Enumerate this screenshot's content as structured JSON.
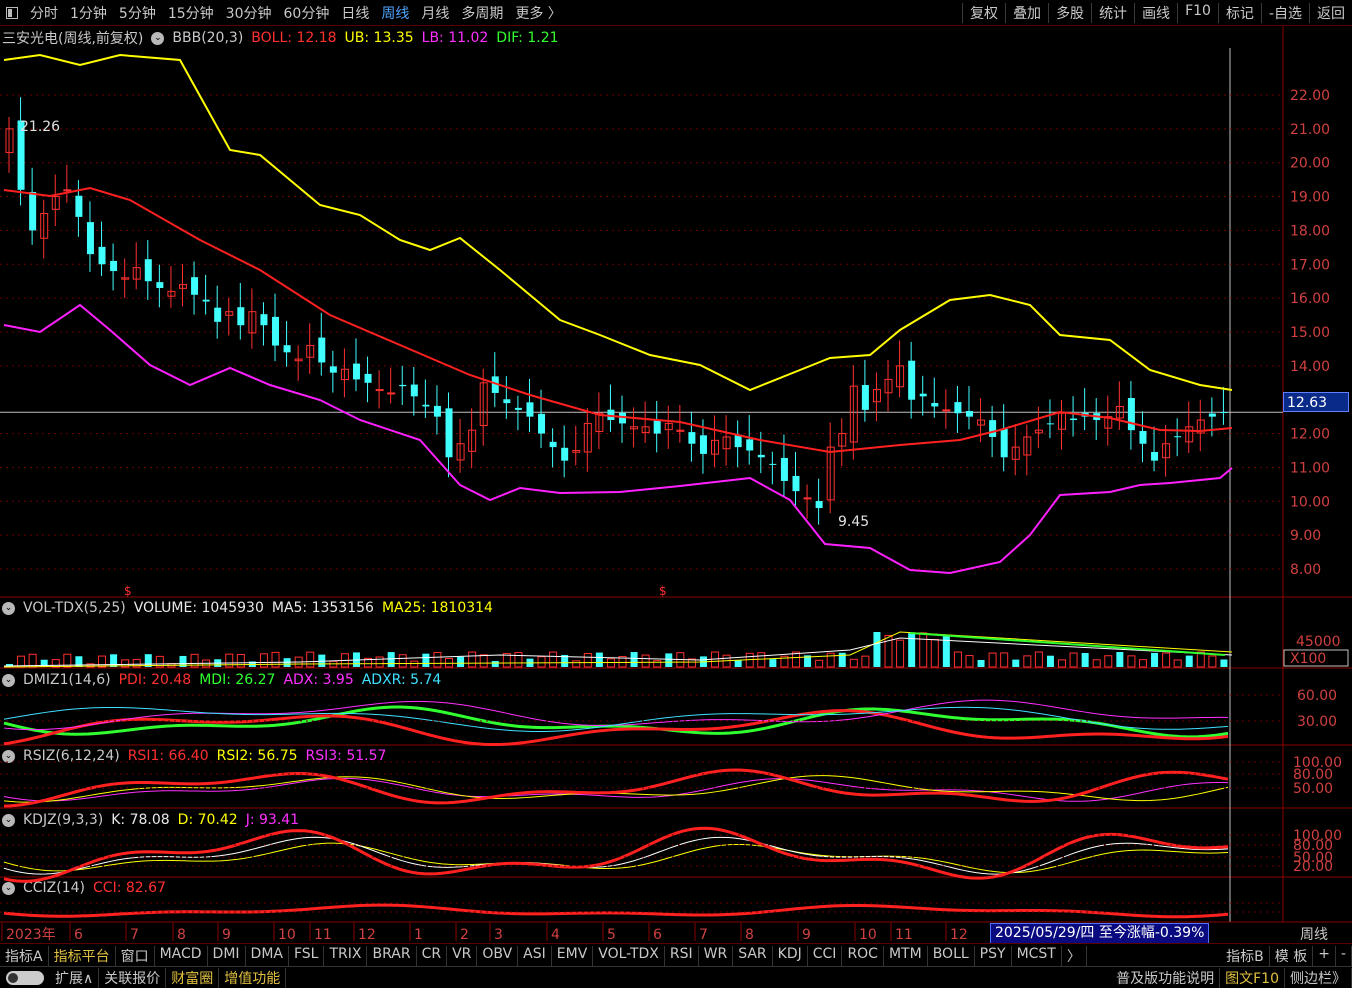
{
  "topbar": {
    "periods": [
      "分时",
      "1分钟",
      "5分钟",
      "15分钟",
      "30分钟",
      "60分钟",
      "日线",
      "周线",
      "月线",
      "多周期",
      "更多 〉"
    ],
    "active_period": "周线",
    "right_buttons": [
      "复权",
      "叠加",
      "多股",
      "统计",
      "画线",
      "F10",
      "标记",
      "-自选",
      "返回"
    ]
  },
  "main": {
    "title": "三安光电(周线,前复权)",
    "indicator": "BBB(20,3)",
    "boll": "BOLL: 12.18",
    "ub": "UB: 13.35",
    "lb": "LB: 11.02",
    "dif": "DIF: 1.21",
    "high_label": "21.26",
    "low_label": "9.45",
    "current_price": "12.63",
    "price_ticks": [
      "22.00",
      "21.00",
      "20.00",
      "19.00",
      "18.00",
      "17.00",
      "16.00",
      "15.00",
      "14.00",
      "12.00",
      "11.00",
      "10.00",
      "9.00",
      "8.00"
    ],
    "dividend_mark": "$",
    "colors": {
      "boll": "#ff2020",
      "ub": "#ffff00",
      "lb": "#ff20ff",
      "up": "#ff3030",
      "down": "#40ffff"
    }
  },
  "vol": {
    "name": "VOL-TDX(5,25)",
    "volume": "VOLUME: 1045930",
    "ma5": "MA5: 1353156",
    "ma25": "MA25: 1810314",
    "tick": "45000",
    "unit": "X100"
  },
  "dmi": {
    "name": "DMIZ1(14,6)",
    "pdi": "PDI: 20.48",
    "mdi": "MDI: 26.27",
    "adx": "ADX: 3.95",
    "adxr": "ADXR: 5.74",
    "ticks": [
      "60.00",
      "30.00"
    ]
  },
  "rsi": {
    "name": "RSIZ(6,12,24)",
    "rsi1": "RSI1: 66.40",
    "rsi2": "RSI2: 56.75",
    "rsi3": "RSI3: 51.57",
    "ticks": [
      "100.00",
      "80.00",
      "50.00"
    ]
  },
  "kdj": {
    "name": "KDJZ(9,3,3)",
    "k": "K: 78.08",
    "d": "D: 70.42",
    "j": "J: 93.41",
    "ticks": [
      "100.00",
      "80.00",
      "50.00",
      "20.00"
    ]
  },
  "cci": {
    "name": "CCIZ(14)",
    "cci": "CCI: 82.67"
  },
  "xaxis": {
    "labels": [
      "2023年",
      "6",
      "7",
      "8",
      "9",
      "10",
      "11",
      "12",
      "1",
      "2",
      "3",
      "4",
      "5",
      "6",
      "7",
      "8",
      "9",
      "10",
      "11",
      "12"
    ],
    "date_box": "2025/05/29/四  至今涨幅-0.39%",
    "period_tag": "周线"
  },
  "bottom_tabs": {
    "tabs": [
      "指标A",
      "指标平台",
      "窗口",
      "MACD",
      "DMI",
      "DMA",
      "FSL",
      "TRIX",
      "BRAR",
      "CR",
      "VR",
      "OBV",
      "ASI",
      "EMV",
      "VOL-TDX",
      "RSI",
      "WR",
      "SAR",
      "KDJ",
      "CCI",
      "ROC",
      "MTM",
      "BOLL",
      "PSY",
      "MCST",
      "〉"
    ],
    "active": "指标平台",
    "right": [
      "指标B",
      "模 板",
      "+",
      "-"
    ]
  },
  "statusbar": {
    "items": [
      "扩展∧",
      "关联报价",
      "财富圈",
      "增值功能"
    ],
    "right": "普及版功能说明",
    "right2": "图文F10",
    "right3": "侧边栏》"
  }
}
